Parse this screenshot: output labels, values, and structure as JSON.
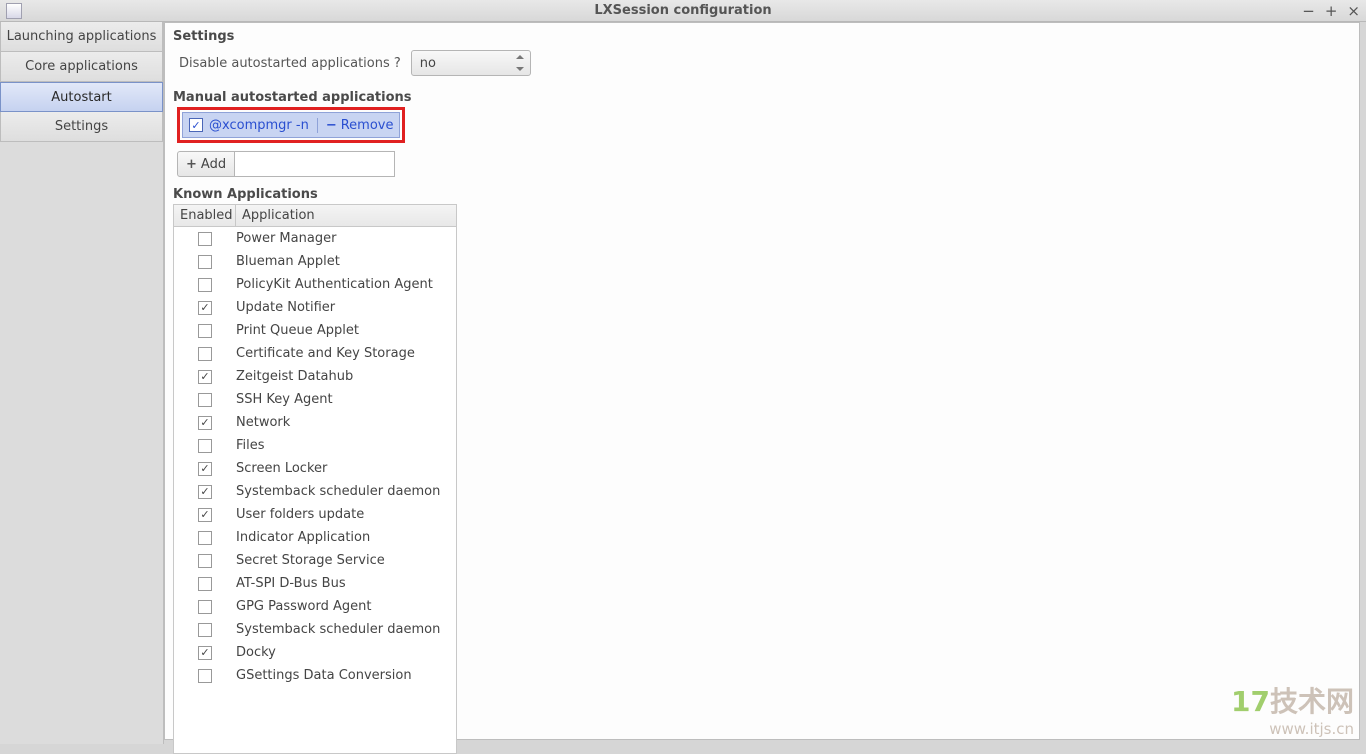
{
  "window": {
    "title": "LXSession configuration"
  },
  "sidebar": {
    "tabs": [
      {
        "label": "Launching applications"
      },
      {
        "label": "Core applications"
      },
      {
        "label": "Autostart"
      },
      {
        "label": "Settings"
      }
    ],
    "selected_index": 2
  },
  "settings": {
    "heading": "Settings",
    "disable_label": "Disable autostarted applications ?",
    "disable_value": "no"
  },
  "manual": {
    "heading": "Manual autostarted applications",
    "entry": {
      "checked": true,
      "command": "@xcompmgr -n",
      "remove_label": "Remove"
    },
    "add_label": "Add",
    "add_value": ""
  },
  "known": {
    "heading": "Known Applications",
    "col_enabled": "Enabled",
    "col_application": "Application",
    "rows": [
      {
        "enabled": false,
        "name": "Power Manager"
      },
      {
        "enabled": false,
        "name": "Blueman Applet"
      },
      {
        "enabled": false,
        "name": "PolicyKit Authentication Agent"
      },
      {
        "enabled": true,
        "name": "Update Notifier"
      },
      {
        "enabled": false,
        "name": "Print Queue Applet"
      },
      {
        "enabled": false,
        "name": "Certificate and Key Storage"
      },
      {
        "enabled": true,
        "name": "Zeitgeist Datahub"
      },
      {
        "enabled": false,
        "name": "SSH Key Agent"
      },
      {
        "enabled": true,
        "name": "Network"
      },
      {
        "enabled": false,
        "name": "Files"
      },
      {
        "enabled": true,
        "name": "Screen Locker"
      },
      {
        "enabled": true,
        "name": "Systemback scheduler daemon"
      },
      {
        "enabled": true,
        "name": "User folders update"
      },
      {
        "enabled": false,
        "name": "Indicator Application"
      },
      {
        "enabled": false,
        "name": "Secret Storage Service"
      },
      {
        "enabled": false,
        "name": "AT-SPI D-Bus Bus"
      },
      {
        "enabled": false,
        "name": "GPG Password Agent"
      },
      {
        "enabled": false,
        "name": "Systemback scheduler daemon"
      },
      {
        "enabled": true,
        "name": "Docky"
      },
      {
        "enabled": false,
        "name": "GSettings Data Conversion"
      }
    ]
  },
  "watermark": {
    "line1a": "17",
    "line1b": "技术网",
    "line2": "www.itjs.cn"
  }
}
